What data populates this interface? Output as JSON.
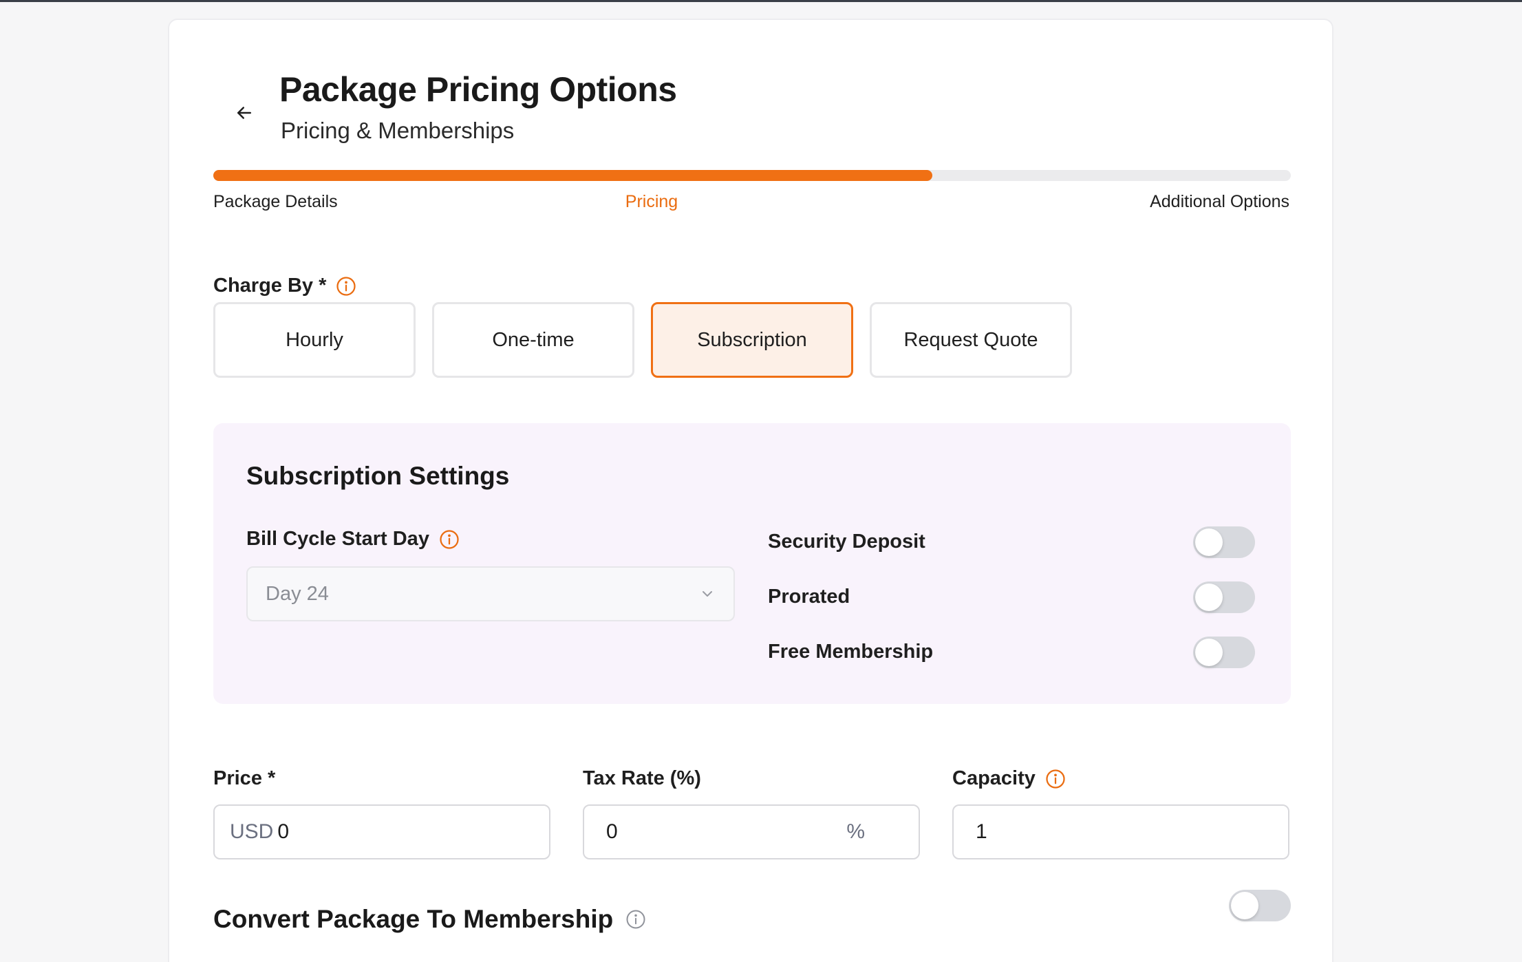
{
  "header": {
    "title": "Package Pricing Options",
    "subtitle": "Pricing & Memberships"
  },
  "progress": {
    "value_fraction": 0.667,
    "steps": [
      {
        "label": "Package Details",
        "state": "done"
      },
      {
        "label": "Pricing",
        "state": "active"
      },
      {
        "label": "Additional Options",
        "state": "upcoming"
      }
    ]
  },
  "charge_by": {
    "label": "Charge By *",
    "options": [
      "Hourly",
      "One-time",
      "Subscription",
      "Request Quote"
    ],
    "selected": "Subscription"
  },
  "subscription_settings": {
    "title": "Subscription Settings",
    "bill_cycle": {
      "label": "Bill Cycle Start Day",
      "value": "Day 24"
    },
    "toggles": [
      {
        "label": "Security Deposit",
        "on": false
      },
      {
        "label": "Prorated",
        "on": false
      },
      {
        "label": "Free Membership",
        "on": false
      }
    ]
  },
  "fields": {
    "price": {
      "label": "Price *",
      "prefix": "USD",
      "value": "0"
    },
    "tax_rate": {
      "label": "Tax Rate (%)",
      "value": "0",
      "suffix": "%"
    },
    "capacity": {
      "label": "Capacity",
      "value": "1"
    }
  },
  "convert": {
    "label": "Convert Package To Membership",
    "on": false
  },
  "colors": {
    "accent": "#f07014",
    "accent_light": "#fdf0e7",
    "panel_bg": "#f9f3fc",
    "toggle_off": "#d7d9de"
  },
  "icons": {
    "back": "arrow-left-icon",
    "info": "info-circle-icon",
    "dropdown": "chevron-down-icon"
  }
}
